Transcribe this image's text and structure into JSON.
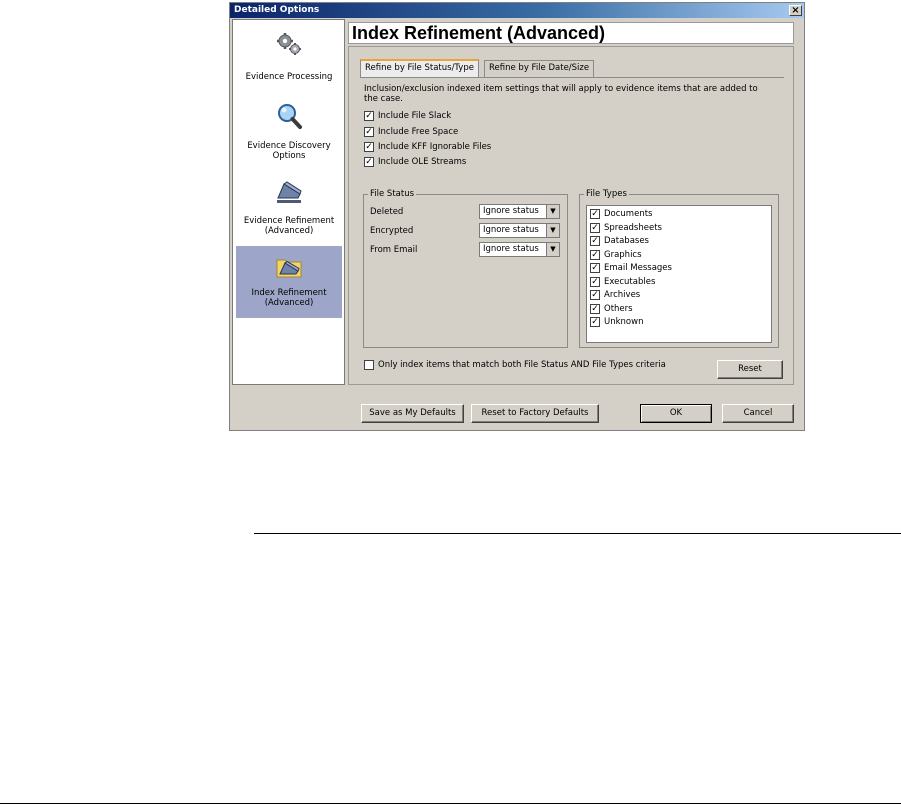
{
  "window": {
    "title": "Detailed Options",
    "close_label": "×"
  },
  "nav": {
    "items": [
      {
        "label": "Evidence Processing",
        "icon": "gears-icon",
        "selected": false
      },
      {
        "label": "Evidence Discovery Options",
        "icon": "magnifier-icon",
        "selected": false
      },
      {
        "label": "Evidence Refinement (Advanced)",
        "icon": "stapler-icon",
        "selected": false
      },
      {
        "label": "Index Refinement (Advanced)",
        "icon": "folder-stapler-icon",
        "selected": true
      }
    ]
  },
  "panel": {
    "title": "Index Refinement (Advanced)"
  },
  "tabs": [
    {
      "label": "Refine by File Status/Type",
      "active": true
    },
    {
      "label": "Refine by File Date/Size",
      "active": false
    }
  ],
  "description": "Inclusion/exclusion indexed item settings that will apply to evidence items that are added to the case.",
  "include_options": [
    {
      "label": "Include File Slack",
      "checked": true
    },
    {
      "label": "Include Free Space",
      "checked": true
    },
    {
      "label": "Include KFF Ignorable Files",
      "checked": true
    },
    {
      "label": "Include OLE Streams",
      "checked": true
    }
  ],
  "file_status": {
    "title": "File Status",
    "rows": [
      {
        "label": "Deleted",
        "value": "Ignore status"
      },
      {
        "label": "Encrypted",
        "value": "Ignore status"
      },
      {
        "label": "From Email",
        "value": "Ignore status"
      }
    ]
  },
  "file_types": {
    "title": "File Types",
    "items": [
      {
        "label": "Documents",
        "checked": true
      },
      {
        "label": "Spreadsheets",
        "checked": true
      },
      {
        "label": "Databases",
        "checked": true
      },
      {
        "label": "Graphics",
        "checked": true
      },
      {
        "label": "Email Messages",
        "checked": true
      },
      {
        "label": "Executables",
        "checked": true
      },
      {
        "label": "Archives",
        "checked": true
      },
      {
        "label": "Others",
        "checked": true
      },
      {
        "label": "Unknown",
        "checked": true
      }
    ]
  },
  "match_both": {
    "label": "Only index items that match both File Status AND File Types criteria",
    "checked": false
  },
  "buttons": {
    "reset": "Reset",
    "save_defaults": "Save as My Defaults",
    "factory_defaults": "Reset to Factory Defaults",
    "ok": "OK",
    "cancel": "Cancel"
  },
  "colors": {
    "titlebar": "#0a246a",
    "selected_nav": "#9da6c9",
    "active_tab_accent": "#e8a53a",
    "dialog_bg": "#d4d0c8"
  }
}
